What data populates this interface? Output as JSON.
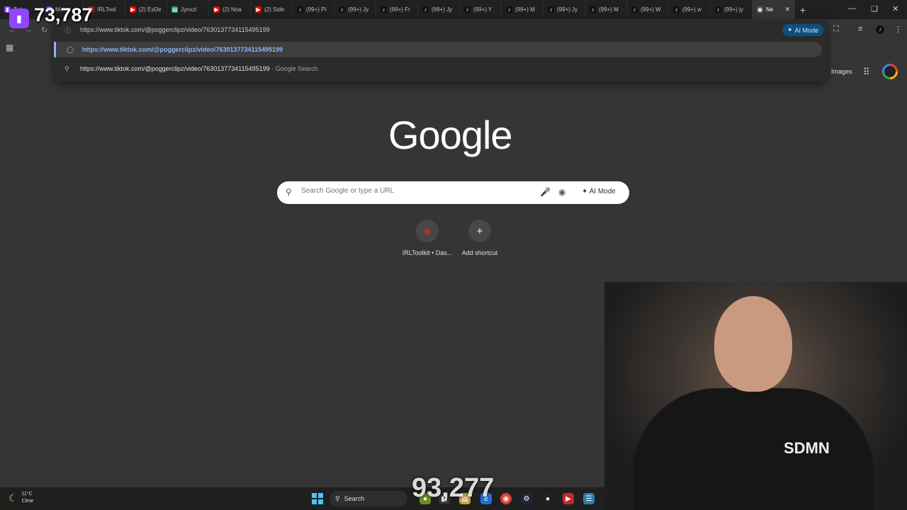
{
  "tabs": [
    {
      "label": "Twi",
      "icon": "twitch-icon",
      "color": "#9146ff"
    },
    {
      "label": "Main",
      "icon": "streamelements-icon",
      "color": "#3d5afe"
    },
    {
      "label": "IRLTool",
      "icon": "irltoolkit-icon",
      "color": "#b71c1c"
    },
    {
      "label": "(2) EsDe",
      "icon": "youtube-icon",
      "color": "#ff0000"
    },
    {
      "label": "Jynxzi",
      "icon": "sheets-icon",
      "color": "#0f9d58"
    },
    {
      "label": "(2) Noa",
      "icon": "youtube-icon",
      "color": "#ff0000"
    },
    {
      "label": "(2) Side",
      "icon": "youtube-icon",
      "color": "#ff0000"
    },
    {
      "label": "(99+) Pi",
      "icon": "tiktok-icon",
      "color": "#111111"
    },
    {
      "label": "(99+) Jy",
      "icon": "tiktok-icon",
      "color": "#111111"
    },
    {
      "label": "(99+) Fr",
      "icon": "tiktok-icon",
      "color": "#111111"
    },
    {
      "label": "(99+) Jy",
      "icon": "tiktok-icon",
      "color": "#111111"
    },
    {
      "label": "(99+) Y",
      "icon": "tiktok-icon",
      "color": "#111111"
    },
    {
      "label": "(99+) M",
      "icon": "tiktok-icon",
      "color": "#111111"
    },
    {
      "label": "(99+) Jy",
      "icon": "tiktok-icon",
      "color": "#111111"
    },
    {
      "label": "(99+) M",
      "icon": "tiktok-icon",
      "color": "#111111"
    },
    {
      "label": "(99+) W",
      "icon": "tiktok-icon",
      "color": "#111111"
    },
    {
      "label": "(99+) w",
      "icon": "tiktok-icon",
      "color": "#111111"
    },
    {
      "label": "(99+) jy",
      "icon": "tiktok-icon",
      "color": "#111111"
    },
    {
      "label": "Ne",
      "icon": "chrome-icon",
      "color": "#555555",
      "active": true
    }
  ],
  "omnibox": {
    "value": "https://www.tiktok.com/@poggerclipz/video/7630137734115495199",
    "ai_mode_label": "AI Mode",
    "suggestions": [
      {
        "text": "https://www.tiktok.com/@poggerclipz/video/7630137734115495199",
        "hint": "",
        "icon": "globe-icon"
      },
      {
        "text": "https://www.tiktok.com/@poggerclipz/video/7630137734115495199",
        "hint": " - Google Search",
        "icon": "search-icon"
      }
    ]
  },
  "header": {
    "images_label": "Images"
  },
  "google": {
    "logo_text": "Google",
    "search_placeholder": "Search Google or type a URL",
    "ai_mode_label": "AI Mode"
  },
  "shortcuts": [
    {
      "label": "IRLToolkit • Das...",
      "icon": "irltoolkit-icon"
    },
    {
      "label": "Add shortcut",
      "icon": "plus-icon"
    }
  ],
  "overlay": {
    "viewer_count": "73,787",
    "bottom_count": "93,277"
  },
  "webcam": {
    "shirt_text": "SDMN"
  },
  "taskbar": {
    "temperature": "11°C",
    "condition": "Clear",
    "search_label": "Search"
  }
}
